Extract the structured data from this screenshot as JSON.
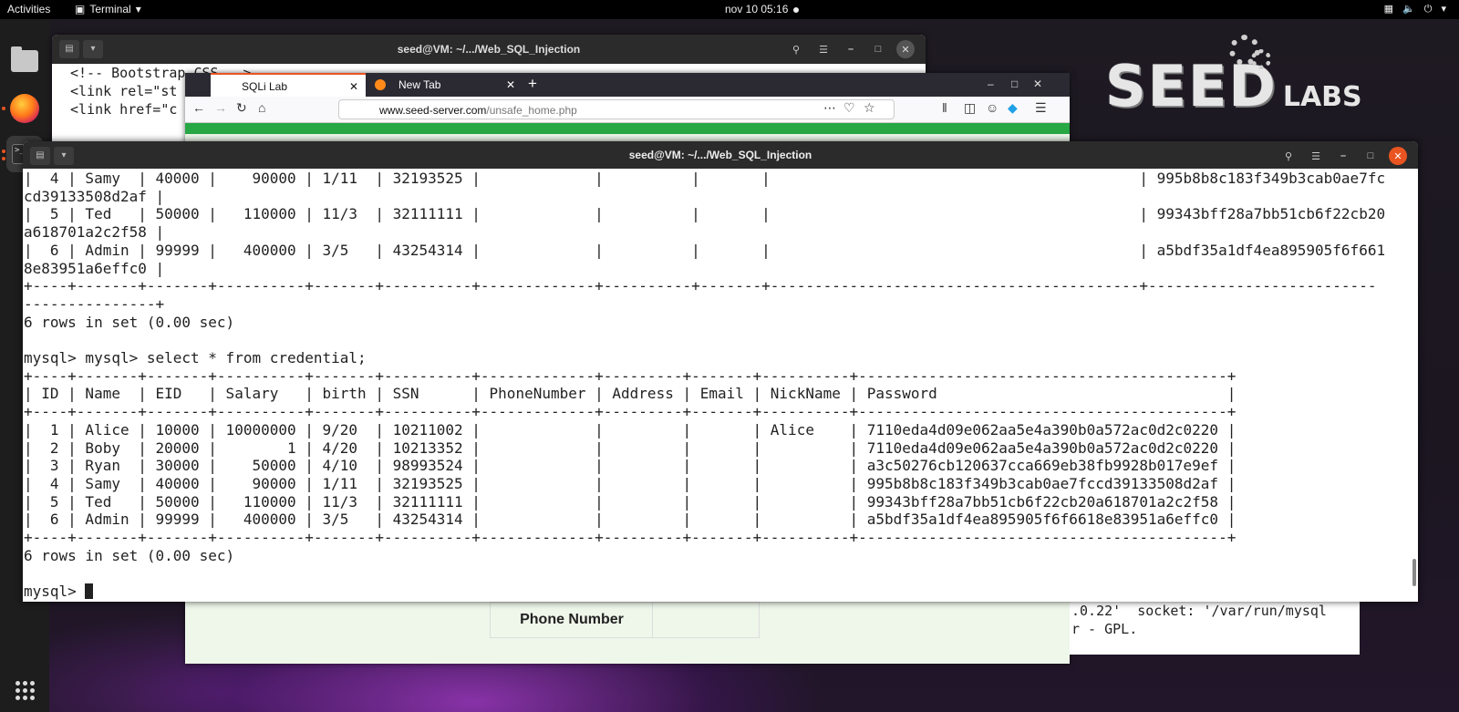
{
  "topbar": {
    "activities": "Activities",
    "app_name": "Terminal",
    "clock": "nov 10  05:16"
  },
  "dock": {
    "items": [
      "files",
      "firefox",
      "terminal",
      "show-applications"
    ]
  },
  "back_terminal": {
    "title": "seed@VM: ~/.../Web_SQL_Injection",
    "lines": [
      "<!-- Bootstrap CSS -->",
      "<link rel=\"st",
      "<link href=\"c"
    ]
  },
  "firefox": {
    "tabs": [
      {
        "label": "SQLi Lab",
        "active": true
      },
      {
        "label": "New Tab",
        "active": false
      }
    ],
    "url_domain": "www.seed-server.com",
    "url_path": "/unsafe_home.php",
    "page": {
      "phone_label": "Phone Number"
    }
  },
  "right_terminal": {
    "lines": [
      ".0.22'  socket: '/var/run/mysql",
      "r - GPL."
    ]
  },
  "main_terminal": {
    "title": "seed@VM: ~/.../Web_SQL_Injection",
    "output": "|  4 | Samy  | 40000 |    90000 | 1/11  | 32193525 |             |          |       |                                          | 995b8b8c183f349b3cab0ae7fc\ncd39133508d2af |\n|  5 | Ted   | 50000 |   110000 | 11/3  | 32111111 |             |          |       |                                          | 99343bff28a7bb51cb6f22cb20\na618701a2c2f58 |\n|  6 | Admin | 99999 |   400000 | 3/5   | 43254314 |             |          |       |                                          | a5bdf35a1df4ea895905f6f661\n8e83951a6effc0 |\n+----+-------+-------+----------+-------+----------+-------------+----------+-------+------------------------------------------+--------------------------\n---------------+\n6 rows in set (0.00 sec)\n\nmysql> mysql> select * from credential;\n+----+-------+-------+----------+-------+----------+-------------+---------+-------+----------+------------------------------------------+\n| ID | Name  | EID   | Salary   | birth | SSN      | PhoneNumber | Address | Email | NickName | Password                                 |\n+----+-------+-------+----------+-------+----------+-------------+---------+-------+----------+------------------------------------------+\n|  1 | Alice | 10000 | 10000000 | 9/20  | 10211002 |             |         |       | Alice    | 7110eda4d09e062aa5e4a390b0a572ac0d2c0220 |\n|  2 | Boby  | 20000 |        1 | 4/20  | 10213352 |             |         |       |          | 7110eda4d09e062aa5e4a390b0a572ac0d2c0220 |\n|  3 | Ryan  | 30000 |    50000 | 4/10  | 98993524 |             |         |       |          | a3c50276cb120637cca669eb38fb9928b017e9ef |\n|  4 | Samy  | 40000 |    90000 | 1/11  | 32193525 |             |         |       |          | 995b8b8c183f349b3cab0ae7fccd39133508d2af |\n|  5 | Ted   | 50000 |   110000 | 11/3  | 32111111 |             |         |       |          | 99343bff28a7bb51cb6f22cb20a618701a2c2f58 |\n|  6 | Admin | 99999 |   400000 | 3/5   | 43254314 |             |         |       |          | a5bdf35a1df4ea895905f6f6618e83951a6effc0 |\n+----+-------+-------+----------+-------+----------+-------------+---------+-------+----------+------------------------------------------+\n6 rows in set (0.00 sec)\n\n",
    "prompt": "mysql> "
  }
}
